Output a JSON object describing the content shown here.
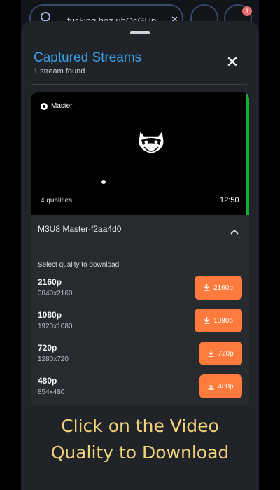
{
  "browser": {
    "url_text": "fucking hoz.uhQcGUp",
    "badge_count": "1"
  },
  "sheet": {
    "title": "Captured Streams",
    "subtitle": "1 stream found"
  },
  "stream": {
    "chip_label": "Master",
    "qualities_text": "4 qualities",
    "duration": "12:50",
    "name": "M3U8 Master-f2aa4d0",
    "select_label": "Select quality to download",
    "qualities": [
      {
        "name": "2160p",
        "resolution": "3840x2160",
        "button_label": "2160p"
      },
      {
        "name": "1080p",
        "resolution": "1920x1080",
        "button_label": "1080p"
      },
      {
        "name": "720p",
        "resolution": "1280x720",
        "button_label": "720p"
      },
      {
        "name": "480p",
        "resolution": "854x480",
        "button_label": "480p"
      }
    ]
  },
  "caption": {
    "line1": "Click on the Video",
    "line2": "Quality to Download"
  },
  "colors": {
    "accent_title": "#3aa0e8",
    "download_button": "#ff7a3d",
    "caption": "#f3d37a",
    "active_indicator": "#11b03a"
  }
}
